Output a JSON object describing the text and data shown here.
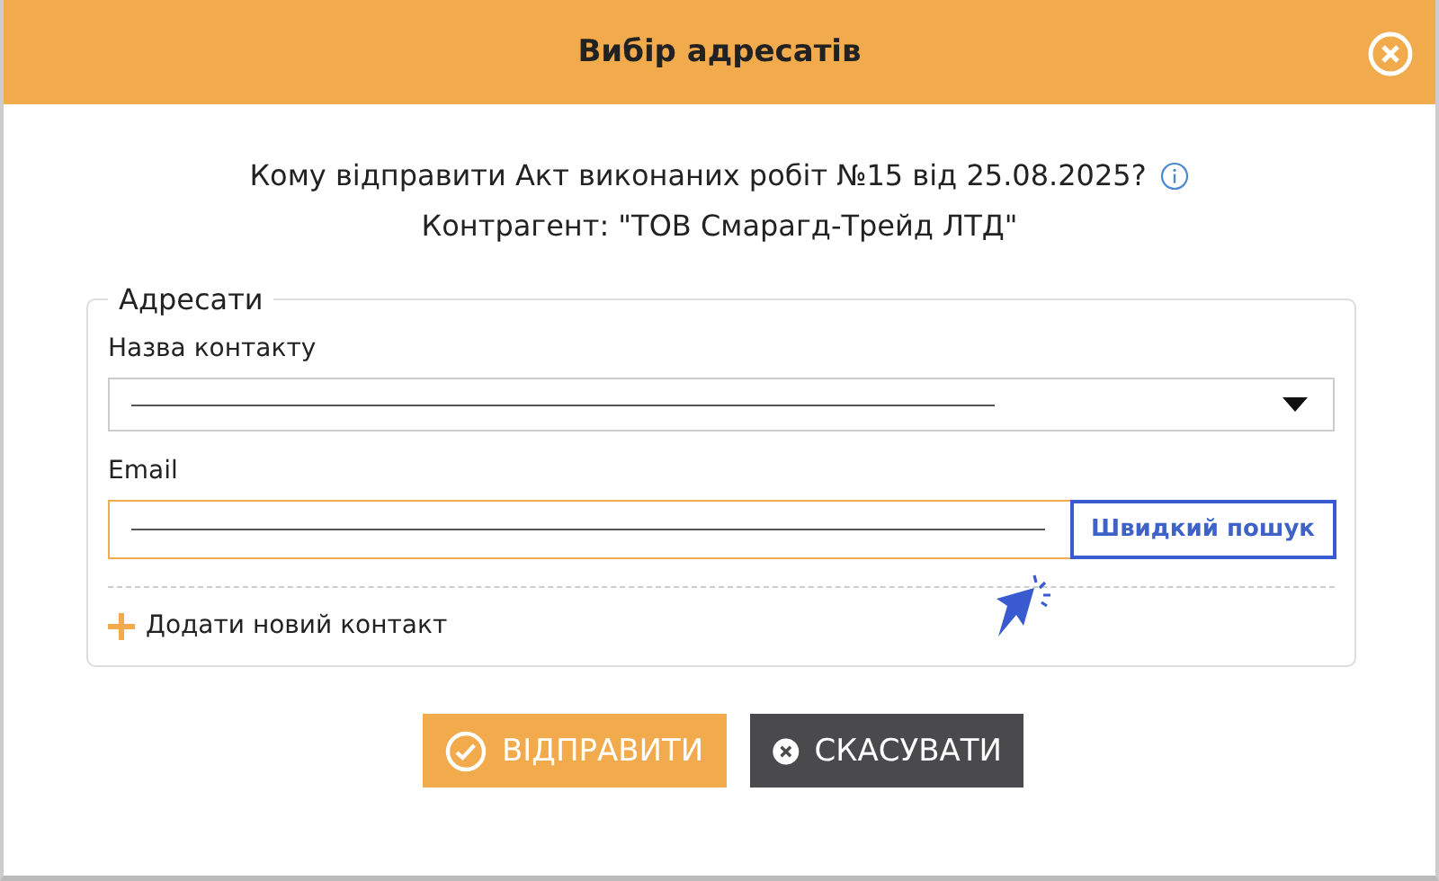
{
  "window": {
    "title": "Вибір адресатів"
  },
  "question": "Кому відправити Акт виконаних робіт №15 від 25.08.2025?",
  "counterparty": "Контрагент: \"ТОВ Смарагд-Трейд ЛТД\"",
  "group": {
    "legend": "Адресати",
    "contact_field": {
      "label": "Назва контакту"
    },
    "email_field": {
      "label": "Email",
      "focused": true
    },
    "quick_search": {
      "label": "Швидкий пошук",
      "highlighted": true
    },
    "add_contact": "Додати новий контакт"
  },
  "buttons": [
    {
      "label": "ВІДПРАВИТИ",
      "kind": "send"
    },
    {
      "label": "СКАСУВАТИ",
      "kind": "cancel"
    }
  ]
}
